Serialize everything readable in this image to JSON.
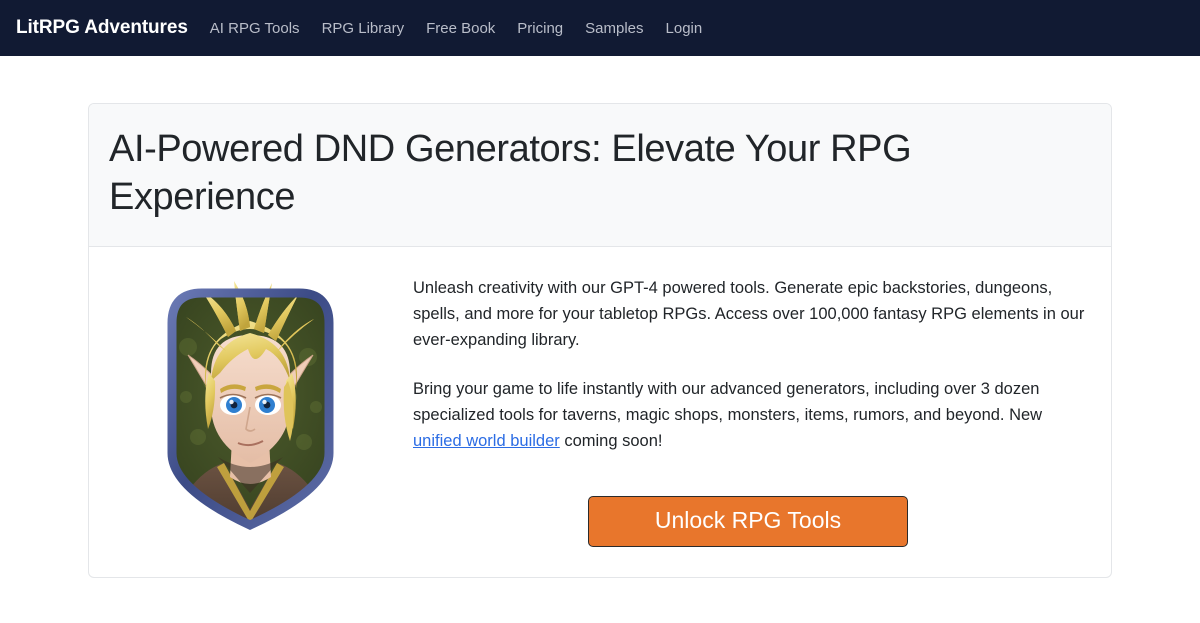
{
  "navbar": {
    "brand": "LitRPG Adventures",
    "links": [
      {
        "label": "AI RPG Tools"
      },
      {
        "label": "RPG Library"
      },
      {
        "label": "Free Book"
      },
      {
        "label": "Pricing"
      },
      {
        "label": "Samples"
      },
      {
        "label": "Login"
      }
    ],
    "background_color": "#111a33",
    "brand_color": "#ffffff",
    "link_color": "#b9bdc9"
  },
  "card": {
    "title": "AI-Powered DND Generators: Elevate Your RPG Experience",
    "header_background": "#f8f9fa",
    "border_color": "#e4e6e9",
    "portrait": {
      "alt": "fantasy-elf-character-portrait",
      "hair_color": "#e8cf6a",
      "skin_color": "#f0d2c0",
      "eye_color": "#2f7fd0",
      "cloak_color": "#5a4437",
      "cloak_trim_color": "#c9a83e",
      "background_color": "#3c4a24",
      "frame_color": "#4a5a96"
    },
    "paragraph_1": "Unleash creativity with our GPT-4 powered tools. Generate epic backstories, dungeons, spells, and more for your tabletop RPGs. Access over 100,000 fantasy RPG elements in our ever-expanding library.",
    "paragraph_2_before": "Bring your game to life instantly with our advanced generators, including over 3 dozen specialized tools for taverns, magic shops, monsters, items, rumors, and beyond. New ",
    "paragraph_2_link": "unified world builder",
    "paragraph_2_after": " coming soon!",
    "link_color": "#2b6ce4",
    "cta_label": "Unlock RPG Tools",
    "cta_background": "#e8762c",
    "cta_text_color": "#ffffff",
    "cta_border_color": "#2b2b2b"
  }
}
